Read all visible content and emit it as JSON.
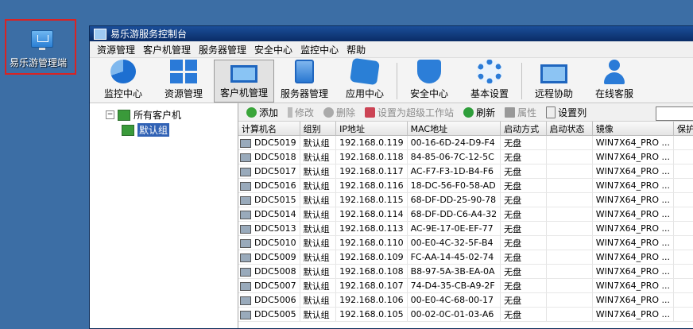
{
  "desktop": {
    "icon_label": "易乐游管理端"
  },
  "window": {
    "title": "易乐游服务控制台"
  },
  "menu": [
    "资源管理",
    "客户机管理",
    "服务器管理",
    "安全中心",
    "监控中心",
    "帮助"
  ],
  "toolbar": [
    {
      "label": "监控中心",
      "icon": "pie-chart-icon"
    },
    {
      "label": "资源管理",
      "icon": "grid-icon"
    },
    {
      "label": "客户机管理",
      "icon": "monitor-icon"
    },
    {
      "label": "服务器管理",
      "icon": "server-icon"
    },
    {
      "label": "应用中心",
      "icon": "puzzle-icon"
    },
    {
      "label": "安全中心",
      "icon": "shield-icon"
    },
    {
      "label": "基本设置",
      "icon": "gear-icon"
    },
    {
      "label": "远程协助",
      "icon": "remote-monitor-icon"
    },
    {
      "label": "在线客服",
      "icon": "user-icon"
    }
  ],
  "tree": {
    "root": "所有客户机",
    "child": "默认组"
  },
  "actions": {
    "add": "添加",
    "edit": "修改",
    "delete": "删除",
    "set_super": "设置为超级工作站",
    "refresh": "刷新",
    "properties": "属性",
    "set_columns": "设置列"
  },
  "table": {
    "columns": [
      "计算机名",
      "组别",
      "IP地址",
      "MAC地址",
      "启动方式",
      "启动状态",
      "镜像",
      "保护"
    ],
    "rows": [
      [
        "DDC5019",
        "默认组",
        "192.168.0.119",
        "00-16-6D-24-D9-F4",
        "无盘",
        "",
        "WIN7X64_PRO ...",
        ""
      ],
      [
        "DDC5018",
        "默认组",
        "192.168.0.118",
        "84-85-06-7C-12-5C",
        "无盘",
        "",
        "WIN7X64_PRO ...",
        ""
      ],
      [
        "DDC5017",
        "默认组",
        "192.168.0.117",
        "AC-F7-F3-1D-B4-F6",
        "无盘",
        "",
        "WIN7X64_PRO ...",
        ""
      ],
      [
        "DDC5016",
        "默认组",
        "192.168.0.116",
        "18-DC-56-F0-58-AD",
        "无盘",
        "",
        "WIN7X64_PRO ...",
        ""
      ],
      [
        "DDC5015",
        "默认组",
        "192.168.0.115",
        "68-DF-DD-25-90-78",
        "无盘",
        "",
        "WIN7X64_PRO ...",
        ""
      ],
      [
        "DDC5014",
        "默认组",
        "192.168.0.114",
        "68-DF-DD-C6-A4-32",
        "无盘",
        "",
        "WIN7X64_PRO ...",
        ""
      ],
      [
        "DDC5013",
        "默认组",
        "192.168.0.113",
        "AC-9E-17-0E-EF-77",
        "无盘",
        "",
        "WIN7X64_PRO ...",
        ""
      ],
      [
        "DDC5010",
        "默认组",
        "192.168.0.110",
        "00-E0-4C-32-5F-B4",
        "无盘",
        "",
        "WIN7X64_PRO ...",
        ""
      ],
      [
        "DDC5009",
        "默认组",
        "192.168.0.109",
        "FC-AA-14-45-02-74",
        "无盘",
        "",
        "WIN7X64_PRO ...",
        ""
      ],
      [
        "DDC5008",
        "默认组",
        "192.168.0.108",
        "B8-97-5A-3B-EA-0A",
        "无盘",
        "",
        "WIN7X64_PRO ...",
        ""
      ],
      [
        "DDC5007",
        "默认组",
        "192.168.0.107",
        "74-D4-35-CB-A9-2F",
        "无盘",
        "",
        "WIN7X64_PRO ...",
        ""
      ],
      [
        "DDC5006",
        "默认组",
        "192.168.0.106",
        "00-E0-4C-68-00-17",
        "无盘",
        "",
        "WIN7X64_PRO ...",
        ""
      ],
      [
        "DDC5005",
        "默认组",
        "192.168.0.105",
        "00-02-0C-01-03-A6",
        "无盘",
        "",
        "WIN7X64_PRO ...",
        ""
      ]
    ]
  }
}
